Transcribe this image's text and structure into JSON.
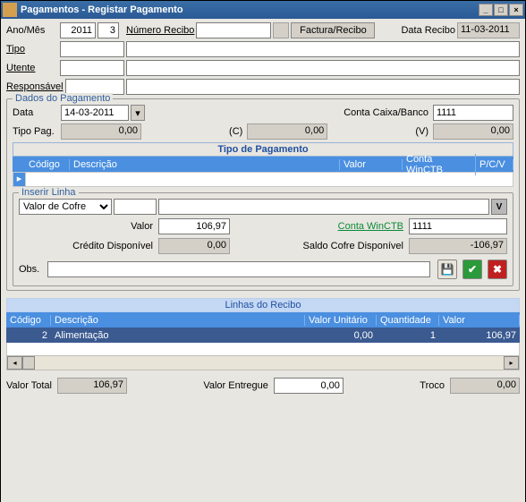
{
  "window": {
    "title": "Pagamentos - Registar Pagamento"
  },
  "header": {
    "ano_mes_label": "Ano/Mês",
    "ano": "2011",
    "mes": "3",
    "numero_recibo_label": "Número Recibo",
    "numero_recibo_value": "",
    "factura_btn": "Factura/Recibo",
    "data_recibo_label": "Data Recibo",
    "data_recibo_value": "11-03-2011",
    "tipo_label": "Tipo",
    "tipo_code": "",
    "tipo_desc": "",
    "utente_label": "Utente",
    "utente_code": "",
    "utente_desc": "",
    "resp_label": "Responsável",
    "resp_code": "",
    "resp_desc": ""
  },
  "dados": {
    "legend": "Dados do Pagamento",
    "data_label": "Data",
    "data_value": "14-03-2011",
    "conta_label": "Conta Caixa/Banco",
    "conta_value": "1111",
    "tipo_pag_label": "Tipo Pag.",
    "tipo_pag_value": "0,00",
    "c_label": "(C)",
    "c_value": "0,00",
    "v_label": "(V)",
    "v_value": "0,00",
    "tp_title": "Tipo de Pagamento",
    "cols": {
      "codigo": "Código",
      "descricao": "Descrição",
      "valor": "Valor",
      "conta": "Conta WinCTB",
      "pcv": "P/C/V"
    },
    "inserir": {
      "legend": "Inserir Linha",
      "valor_cofre_sel": "Valor de Cofre",
      "codigo_value": "",
      "desc_value": "",
      "v_btn": "V",
      "valor_label": "Valor",
      "valor_value": "106,97",
      "conta_link": "Conta WinCTB",
      "conta_value": "1111",
      "credito_label": "Crédito Disponível",
      "credito_value": "0,00",
      "saldo_label": "Saldo Cofre Disponível",
      "saldo_value": "-106,97",
      "obs_label": "Obs.",
      "obs_value": ""
    }
  },
  "linhas": {
    "title": "Linhas do Recibo",
    "cols": {
      "codigo": "Código",
      "descricao": "Descrição",
      "val_unit": "Valor Unitário",
      "qtd": "Quantidade",
      "valor": "Valor"
    },
    "row": {
      "codigo": "2",
      "descricao": "Alimentação",
      "val_unit": "0,00",
      "qtd": "1",
      "valor": "106,97"
    }
  },
  "footer": {
    "valor_total_label": "Valor Total",
    "valor_total_value": "106,97",
    "valor_entregue_label": "Valor Entregue",
    "valor_entregue_value": "0,00",
    "troco_label": "Troco",
    "troco_value": "0,00"
  }
}
